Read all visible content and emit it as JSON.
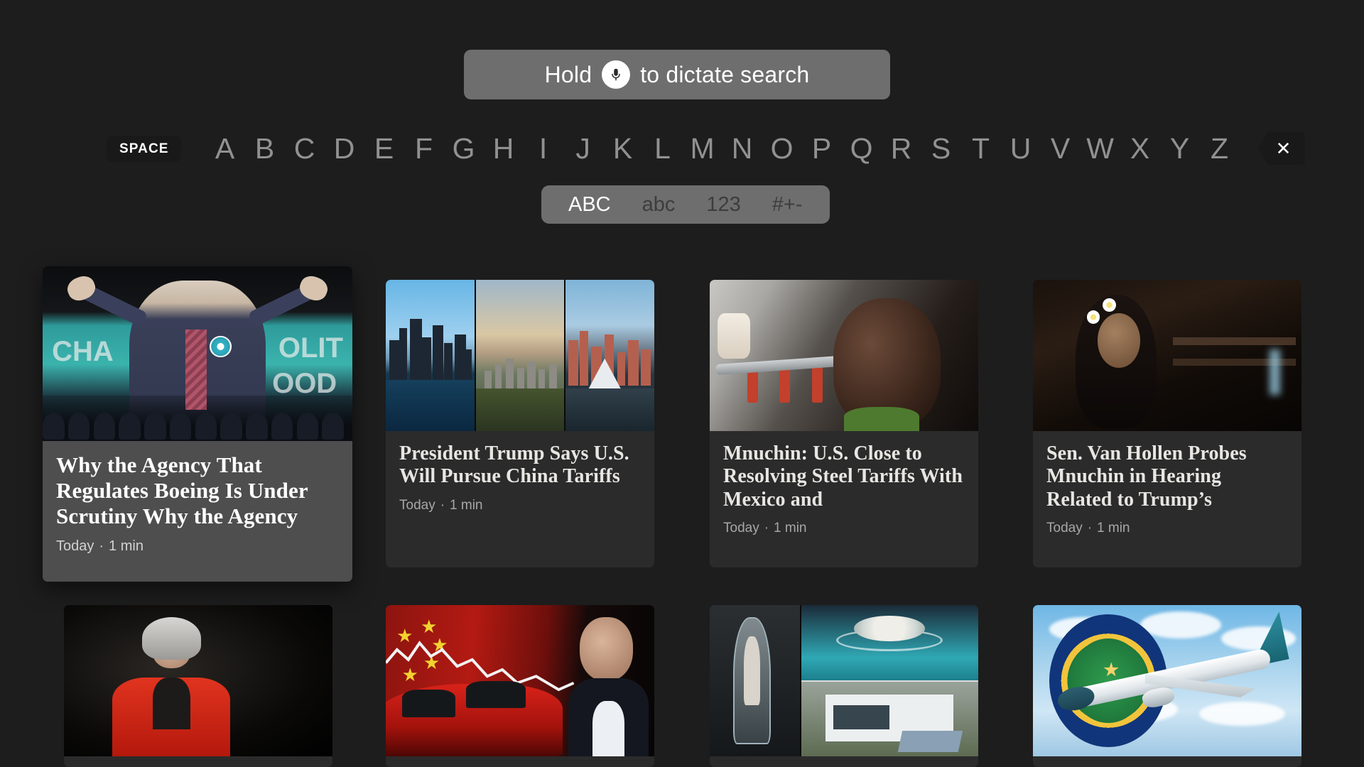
{
  "dictate": {
    "prefix": "Hold",
    "suffix": "to dictate search",
    "mic_icon": "microphone-icon"
  },
  "keyboard": {
    "space_label": "SPACE",
    "letters": [
      "A",
      "B",
      "C",
      "D",
      "E",
      "F",
      "G",
      "H",
      "I",
      "J",
      "K",
      "L",
      "M",
      "N",
      "O",
      "P",
      "Q",
      "R",
      "S",
      "T",
      "U",
      "V",
      "W",
      "X",
      "Y",
      "Z"
    ],
    "delete_icon": "close-x-icon",
    "modes": [
      {
        "label": "ABC",
        "active": true
      },
      {
        "label": "abc",
        "active": false
      },
      {
        "label": "123",
        "active": false
      },
      {
        "label": "#+-",
        "active": false
      }
    ]
  },
  "colors": {
    "background": "#1d1d1d",
    "card": "#2b2b2b",
    "card_focused": "#4e4e4e",
    "pill": "#6e6e6e",
    "key_dark": "#191919",
    "letter": "#919191",
    "headline": "#e8e6e3",
    "subtext": "#a7a7a7"
  },
  "results": {
    "row1": [
      {
        "headline": "Why the Agency That Regulates Boeing Is Under Scrutiny Why the Agency",
        "date": "Today",
        "separator": "·",
        "duration": "1 min",
        "image": "nigel-farage-rally-photo",
        "focused": true
      },
      {
        "headline": "President Trump Says U.S. Will Pursue China Tariffs",
        "date": "Today",
        "separator": "·",
        "duration": "1 min",
        "image": "three-city-skyline-collage",
        "focused": false
      },
      {
        "headline": "Mnuchin: U.S. Close to Resolving Steel Tariffs With Mexico and",
        "date": "Today",
        "separator": "·",
        "duration": "1 min",
        "image": "woman-in-aircraft-photo",
        "focused": false
      },
      {
        "headline": "Sen. Van Hollen Probes Mnuchin in Hearing Related to Trump’s",
        "date": "Today",
        "separator": "·",
        "duration": "1 min",
        "image": "girl-with-flowers-photo",
        "focused": false
      }
    ],
    "row2": [
      {
        "image": "theresa-may-photo"
      },
      {
        "image": "tesla-china-flag-photo"
      },
      {
        "image": "elevator-house-collage"
      },
      {
        "image": "faa-boeing-logo-photo"
      }
    ]
  }
}
